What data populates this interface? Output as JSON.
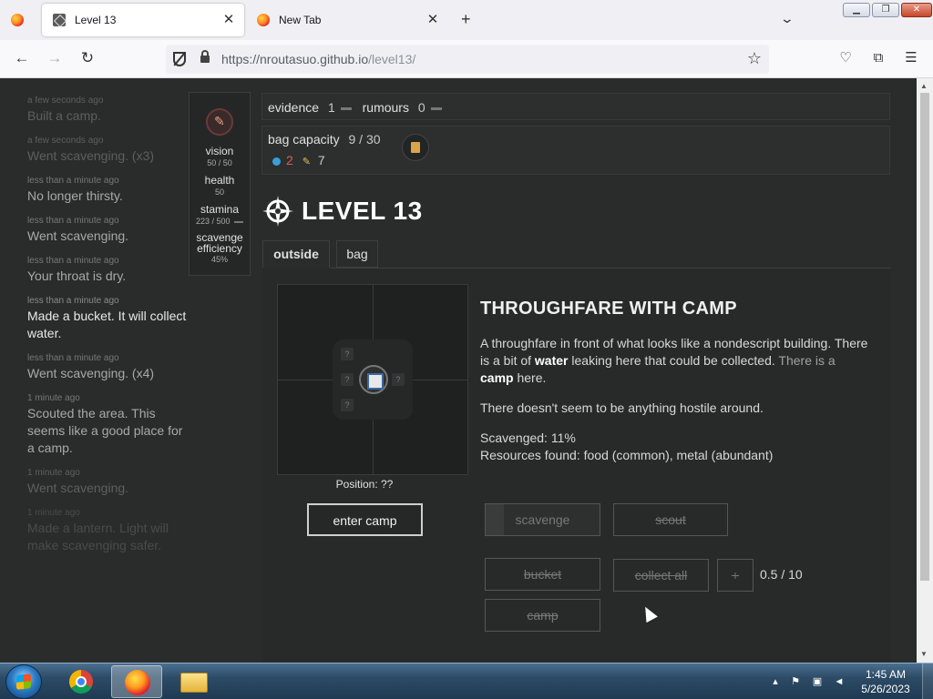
{
  "browser": {
    "tabs": [
      {
        "title": "Level 13",
        "active": true
      },
      {
        "title": "New Tab",
        "active": false
      }
    ],
    "new_tab_label": "+",
    "url_origin": "https://nroutasuo.github.io",
    "url_path": "/level13/"
  },
  "log": [
    {
      "time": "a few seconds ago",
      "text": "Built a camp."
    },
    {
      "time": "a few seconds ago",
      "text": "Went scavenging. (x3)"
    },
    {
      "time": "less than a minute ago",
      "text": "No longer thirsty."
    },
    {
      "time": "less than a minute ago",
      "text": "Went scavenging."
    },
    {
      "time": "less than a minute ago",
      "text": "Your throat is dry."
    },
    {
      "time": "less than a minute ago",
      "text": "Made a bucket. It will collect water."
    },
    {
      "time": "less than a minute ago",
      "text": "Went scavenging. (x4)"
    },
    {
      "time": "1 minute ago",
      "text": "Scouted the area. This seems like a good place for a camp."
    },
    {
      "time": "1 minute ago",
      "text": "Went scavenging."
    },
    {
      "time": "1 minute ago",
      "text": "Made a lantern. Light will make scavenging safer."
    }
  ],
  "stats": {
    "vision_label": "vision",
    "vision_value": "50 / 50",
    "health_label": "health",
    "health_value": "50",
    "stamina_label": "stamina",
    "stamina_value": "223 / 500",
    "scavenge_label": "scavenge efficiency",
    "scavenge_value": "45%"
  },
  "resources_bar": {
    "evidence_label": "evidence",
    "evidence_value": "1",
    "rumours_label": "rumours",
    "rumours_value": "0"
  },
  "bag_bar": {
    "capacity_label": "bag capacity",
    "capacity_value": "9 / 30",
    "water_count": "2",
    "metal_count": "7"
  },
  "level_title": "LEVEL 13",
  "game_tabs": [
    {
      "label": "outside",
      "active": true
    },
    {
      "label": "bag",
      "active": false
    }
  ],
  "map": {
    "unknown_marker": "?",
    "position_label": "Position: ??"
  },
  "location": {
    "title": "THROUGHFARE WITH CAMP",
    "desc_part1": "A throughfare in front of what looks like a nondescript building.",
    "desc_part2": "There is a bit of",
    "desc_water": "water",
    "desc_part3": "leaking here that could be collected.",
    "desc_part4": "There is a",
    "desc_camp": "camp",
    "desc_part5": "here.",
    "hostile": "There doesn't seem to be anything hostile around.",
    "scavenged": "Scavenged: 11%",
    "resources_found": "Resources found: food (common), metal (abundant)"
  },
  "actions": {
    "enter_camp": "enter camp",
    "scavenge": "scavenge",
    "scout": "scout",
    "bucket": "bucket",
    "collect_all": "collect all",
    "plus": "+",
    "collect_counter": "0.5 / 10",
    "camp": "camp"
  },
  "taskbar": {
    "time": "1:45 AM",
    "date": "5/26/2023"
  },
  "colors": {
    "page_bg": "#2a2c2c",
    "water_dot": "#3a9fd8",
    "water_count": "#e05a5a",
    "metal_icon": "#e8c060"
  }
}
